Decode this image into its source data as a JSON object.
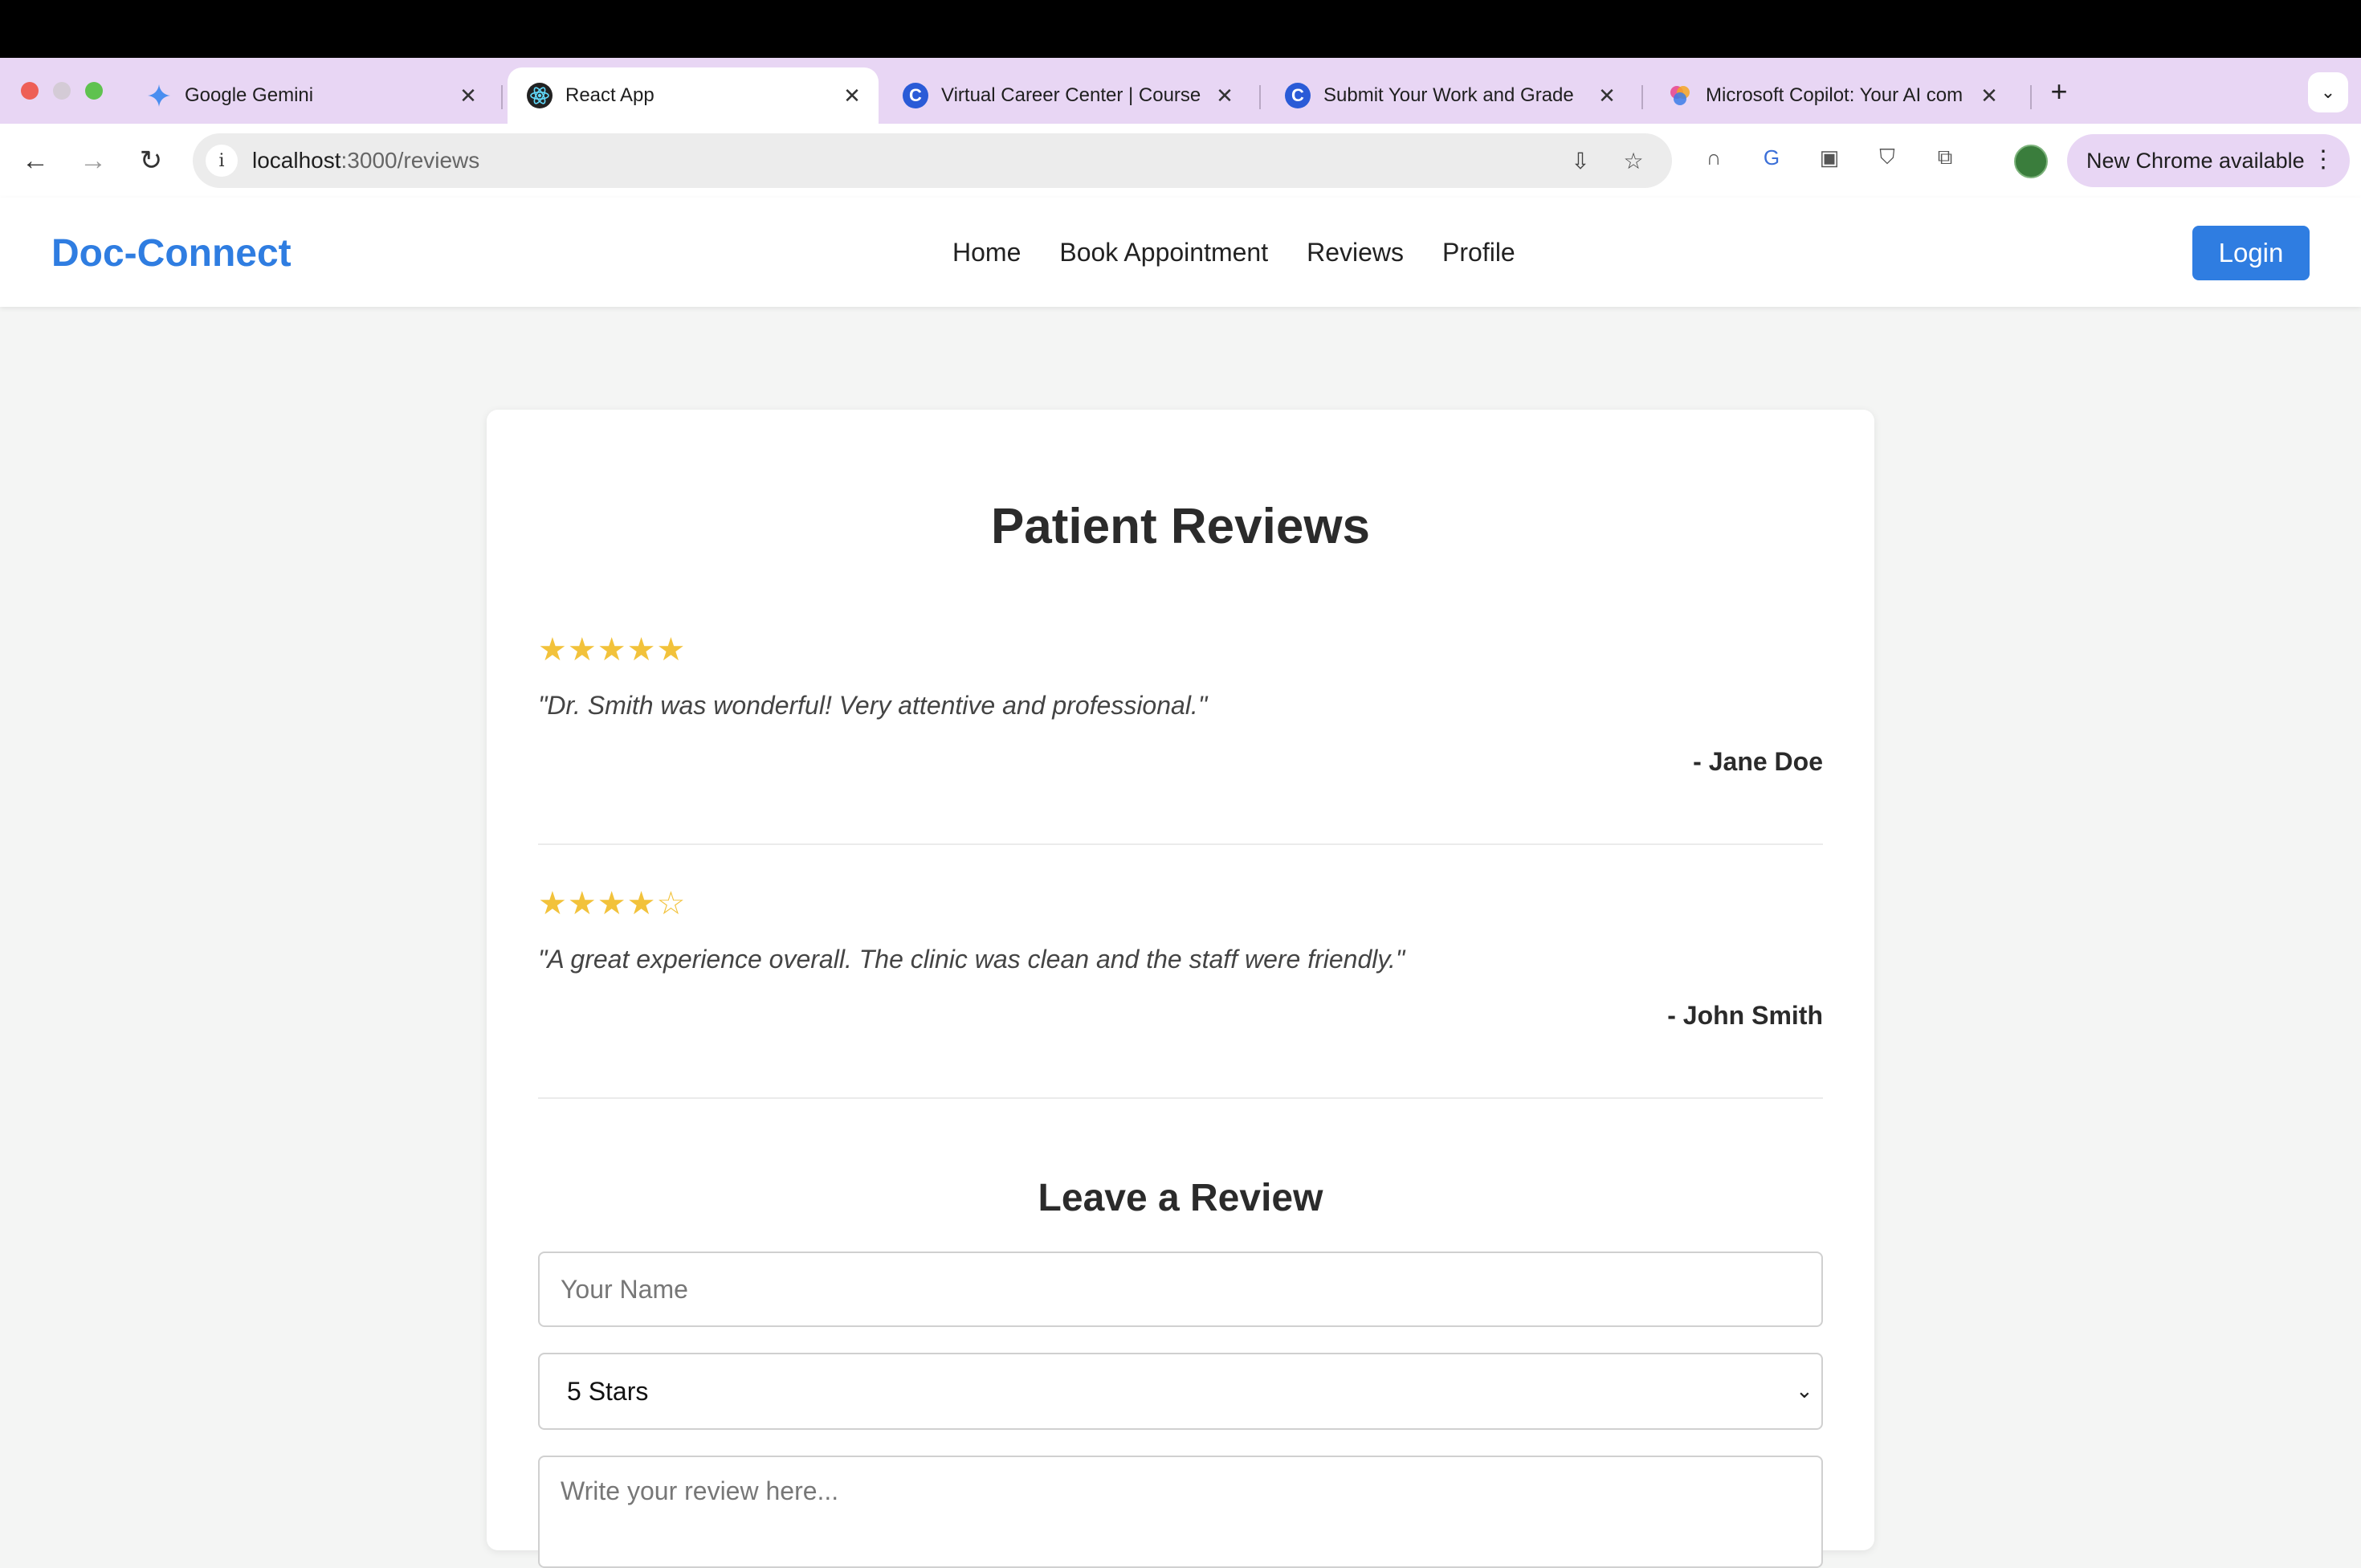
{
  "browser": {
    "tabs": [
      {
        "title": "Google Gemini",
        "icon": "gemini-icon",
        "active": false
      },
      {
        "title": "React App",
        "icon": "react-icon",
        "active": true
      },
      {
        "title": "Virtual Career Center | Course",
        "icon": "coursera-icon",
        "active": false
      },
      {
        "title": "Submit Your Work and Grade",
        "icon": "coursera-icon",
        "active": false
      },
      {
        "title": "Microsoft Copilot: Your AI com",
        "icon": "copilot-icon",
        "active": false
      }
    ],
    "url_host": "localhost",
    "url_path": ":3000/reviews",
    "update_label": "New Chrome available"
  },
  "app": {
    "brand": "Doc-Connect",
    "nav": [
      "Home",
      "Book Appointment",
      "Reviews",
      "Profile"
    ],
    "login_label": "Login"
  },
  "page": {
    "title": "Patient Reviews",
    "reviews": [
      {
        "rating": 5,
        "stars": "★★★★★",
        "text": "\"Dr. Smith was wonderful! Very attentive and professional.\"",
        "author": "- Jane Doe"
      },
      {
        "rating": 4,
        "stars": "★★★★☆",
        "text": "\"A great experience overall. The clinic was clean and the staff were friendly.\"",
        "author": "- John Smith"
      }
    ],
    "form": {
      "title": "Leave a Review",
      "name_placeholder": "Your Name",
      "rating_selected": "5 Stars",
      "review_placeholder": "Write your review here..."
    }
  },
  "colors": {
    "brand": "#2f7de1",
    "star": "#f2c23b",
    "tab_strip": "#e8d6f4"
  }
}
